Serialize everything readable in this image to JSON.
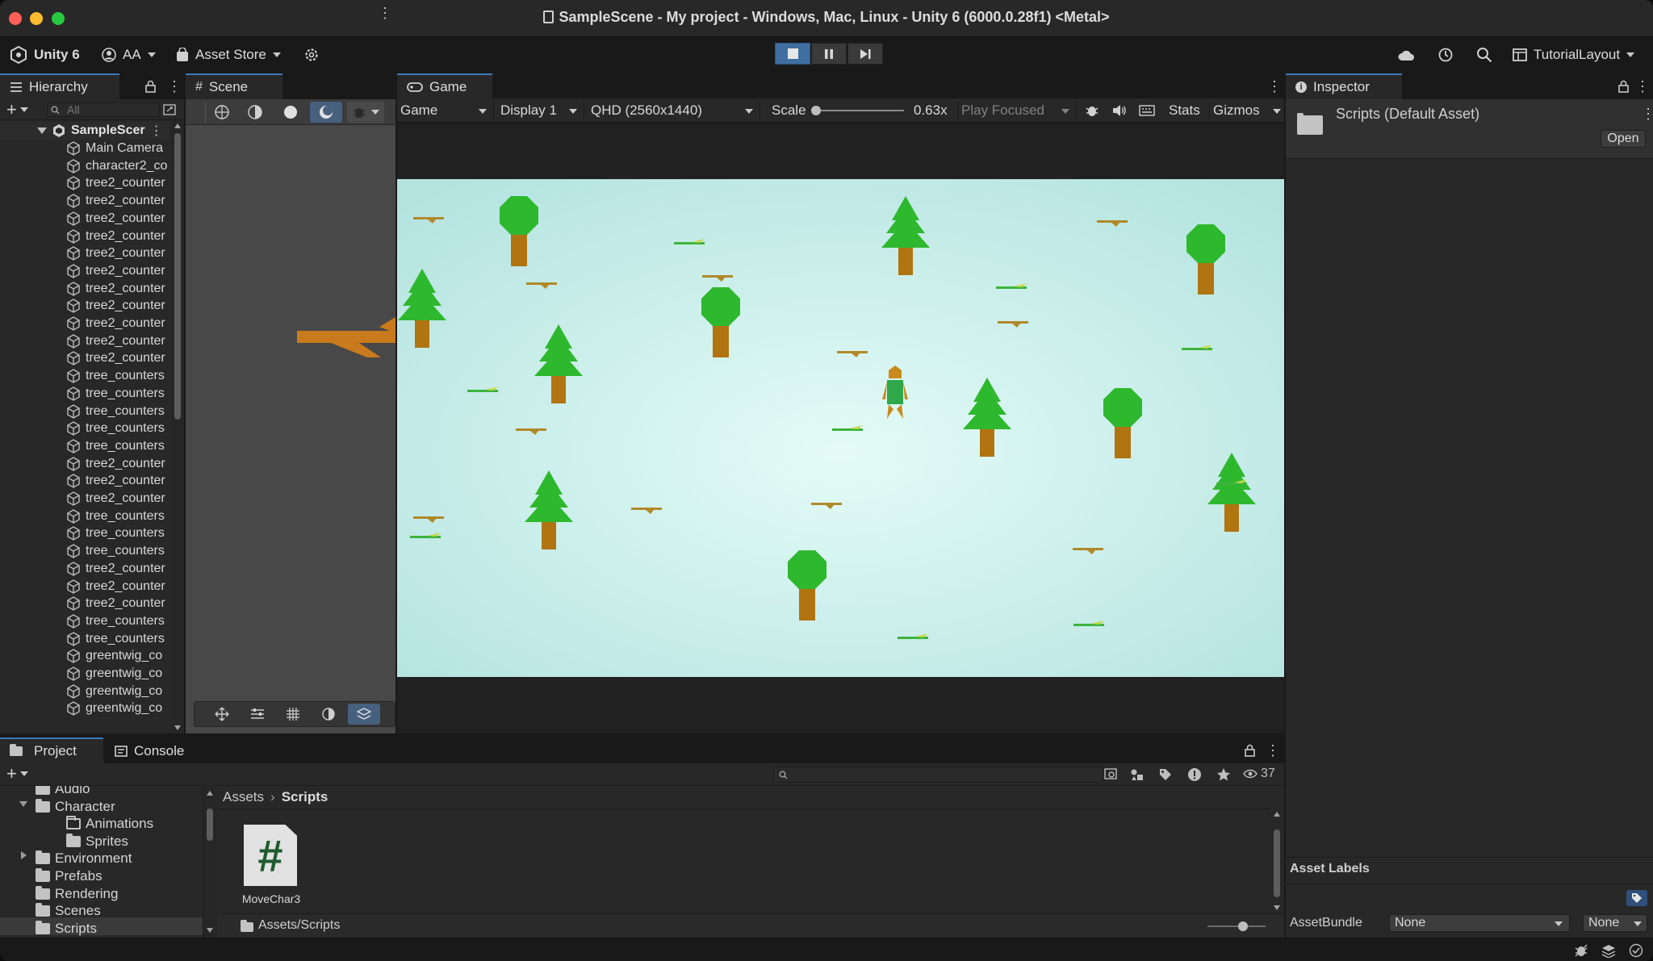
{
  "window": {
    "title": "SampleScene - My project - Windows, Mac, Linux - Unity 6 (6000.0.28f1) <Metal>"
  },
  "toolbar": {
    "unity_label": "Unity 6",
    "account_label": "AA",
    "asset_store_label": "Asset Store",
    "layout_label": "TutorialLayout"
  },
  "hierarchy": {
    "tab_label": "Hierarchy",
    "search_placeholder": "All",
    "scene_name": "SampleScer",
    "items": [
      "Main Camera",
      "character2_co",
      "tree2_counter",
      "tree2_counter",
      "tree2_counter",
      "tree2_counter",
      "tree2_counter",
      "tree2_counter",
      "tree2_counter",
      "tree2_counter",
      "tree2_counter",
      "tree2_counter",
      "tree2_counter",
      "tree_counters",
      "tree_counters",
      "tree_counters",
      "tree_counters",
      "tree_counters",
      "tree2_counter",
      "tree2_counter",
      "tree2_counter",
      "tree_counters",
      "tree_counters",
      "tree_counters",
      "tree2_counter",
      "tree2_counter",
      "tree2_counter",
      "tree_counters",
      "tree_counters",
      "greentwig_co",
      "greentwig_co",
      "greentwig_co",
      "greentwig_co"
    ]
  },
  "scene": {
    "tab_label": "Scene"
  },
  "game": {
    "tab_label": "Game",
    "view_select": "Game",
    "display_select": "Display 1",
    "resolution_select": "QHD (2560x1440)",
    "scale_label": "Scale",
    "scale_value": "0.63x",
    "play_mode_select": "Play Focused",
    "stats_label": "Stats",
    "gizmos_label": "Gizmos"
  },
  "inspector": {
    "tab_label": "Inspector",
    "asset_title": "Scripts (Default Asset)",
    "open_button": "Open",
    "asset_labels_header": "Asset Labels",
    "assetbundle_label": "AssetBundle",
    "assetbundle_value": "None",
    "assetbundle_variant": "None"
  },
  "project": {
    "tab_label": "Project",
    "console_tab_label": "Console",
    "hidden_count": "37",
    "tree": [
      {
        "label": "Audio",
        "indent": 1,
        "arrow": false
      },
      {
        "label": "Character",
        "indent": 1,
        "arrow": "open"
      },
      {
        "label": "Animations",
        "indent": 2,
        "arrow": false,
        "outline": true
      },
      {
        "label": "Sprites",
        "indent": 2,
        "arrow": false
      },
      {
        "label": "Environment",
        "indent": 1,
        "arrow": "closed"
      },
      {
        "label": "Prefabs",
        "indent": 1,
        "arrow": false
      },
      {
        "label": "Rendering",
        "indent": 1,
        "arrow": false
      },
      {
        "label": "Scenes",
        "indent": 1,
        "arrow": false
      },
      {
        "label": "Scripts",
        "indent": 1,
        "arrow": false,
        "selected": true
      }
    ],
    "breadcrumb_root": "Assets",
    "breadcrumb_current": "Scripts",
    "file_name": "MoveChar3",
    "path_label": "Assets/Scripts"
  },
  "colors": {
    "accent": "#3a79bb",
    "panel": "#282828",
    "background": "#191919",
    "game_sky": "#bfe9e6",
    "tree_green": "#2eb82e",
    "trunk": "#b07410"
  }
}
